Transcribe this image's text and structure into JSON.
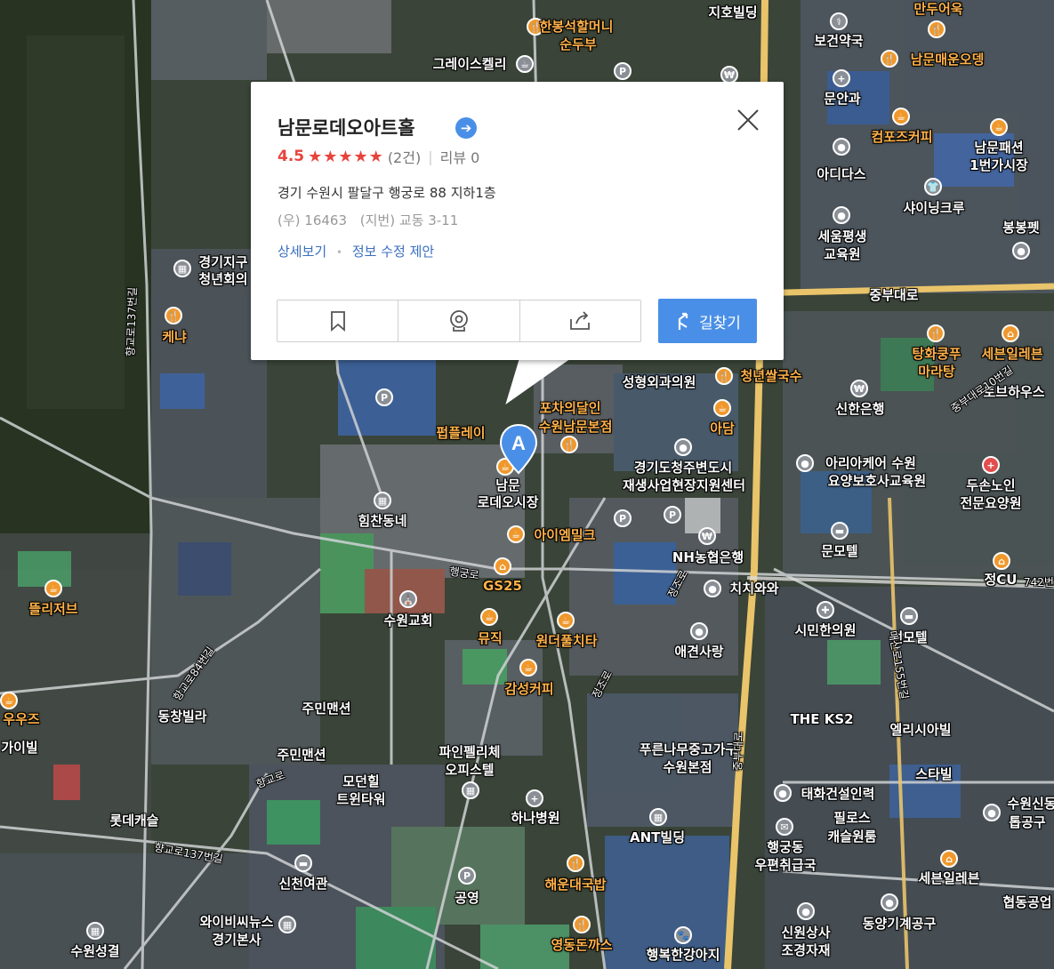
{
  "popup": {
    "title": "남문로데오아트홀",
    "rating_score": "4.5",
    "rating_stars": "★★★★★",
    "rating_count": "(2건)",
    "review_label": "리뷰 0",
    "address": "경기 수원시 팔달구 행궁로 88 지하1층",
    "postal": "(우) 16463",
    "lot_address": "(지번) 교동 3-11",
    "link_detail": "상세보기",
    "link_edit": "정보 수정 제안",
    "route_label": "길찾기"
  },
  "pin_letter": "A",
  "colors": {
    "accent_blue": "#4a8fe7",
    "star_red": "#e7433d",
    "road_yellow": "#e9c46a",
    "label_orange": "#ffb24a"
  },
  "labels": [
    {
      "text": "한봉석할머니",
      "style": "orange"
    },
    {
      "text": "순두부",
      "style": "orange"
    },
    {
      "text": "지호빌딩",
      "style": "white"
    },
    {
      "text": "만두어욱",
      "style": "orange"
    },
    {
      "text": "보건약국",
      "style": "white"
    },
    {
      "text": "그레이스켈리",
      "style": "white"
    },
    {
      "text": "남문매운오뎅",
      "style": "orange"
    },
    {
      "text": "문안과",
      "style": "white"
    },
    {
      "text": "컴포즈커피",
      "style": "orange"
    },
    {
      "text": "남문패션",
      "style": "white"
    },
    {
      "text": "1번가시장",
      "style": "white"
    },
    {
      "text": "아디다스",
      "style": "white"
    },
    {
      "text": "샤이닝크루",
      "style": "white"
    },
    {
      "text": "세움평생",
      "style": "white"
    },
    {
      "text": "교육원",
      "style": "white"
    },
    {
      "text": "봉봉펫",
      "style": "white"
    },
    {
      "text": "경기지구",
      "style": "white"
    },
    {
      "text": "청년회의",
      "style": "white"
    },
    {
      "text": "중부대로",
      "style": "white"
    },
    {
      "text": "케냐",
      "style": "orange"
    },
    {
      "text": "탕화쿵푸",
      "style": "orange"
    },
    {
      "text": "마라탕",
      "style": "orange"
    },
    {
      "text": "세븐일레븐",
      "style": "orange"
    },
    {
      "text": "토브하우스",
      "style": "white"
    },
    {
      "text": "성형외과의원",
      "style": "white"
    },
    {
      "text": "청년쌀국수",
      "style": "orange"
    },
    {
      "text": "신한은행",
      "style": "white"
    },
    {
      "text": "포차의달인",
      "style": "orange"
    },
    {
      "text": "수원남문본점",
      "style": "orange"
    },
    {
      "text": "펍플레이",
      "style": "orange"
    },
    {
      "text": "아담",
      "style": "orange"
    },
    {
      "text": "경기도청주변도시",
      "style": "white"
    },
    {
      "text": "재생사업현장지원센터",
      "style": "white"
    },
    {
      "text": "아리아케어 수원",
      "style": "white"
    },
    {
      "text": "요양보호사교육원",
      "style": "white"
    },
    {
      "text": "두손노인",
      "style": "white"
    },
    {
      "text": "전문요양원",
      "style": "white"
    },
    {
      "text": "남문",
      "style": "white"
    },
    {
      "text": "로데오시장",
      "style": "white"
    },
    {
      "text": "힘찬동네",
      "style": "white"
    },
    {
      "text": "아이엠밀크",
      "style": "orange"
    },
    {
      "text": "NH농협은행",
      "style": "white"
    },
    {
      "text": "문모텔",
      "style": "white"
    },
    {
      "text": "GS25",
      "style": "orange"
    },
    {
      "text": "치치와와",
      "style": "white"
    },
    {
      "text": "정CU",
      "style": "white"
    },
    {
      "text": "뜰리저브",
      "style": "orange"
    },
    {
      "text": "수원교회",
      "style": "white"
    },
    {
      "text": "뮤직",
      "style": "orange"
    },
    {
      "text": "원더풀치타",
      "style": "orange"
    },
    {
      "text": "시민한의원",
      "style": "white"
    },
    {
      "text": "썬모텔",
      "style": "white"
    },
    {
      "text": "애견사랑",
      "style": "white"
    },
    {
      "text": "우우즈",
      "style": "orange"
    },
    {
      "text": "동창빌라",
      "style": "white"
    },
    {
      "text": "감성커피",
      "style": "orange"
    },
    {
      "text": "주민맨션",
      "style": "white"
    },
    {
      "text": "THE KS2",
      "style": "white"
    },
    {
      "text": "엘리시아빌",
      "style": "white"
    },
    {
      "text": "가이빌",
      "style": "white"
    },
    {
      "text": "파인펠리체",
      "style": "white"
    },
    {
      "text": "오피스텔",
      "style": "white"
    },
    {
      "text": "푸른나무중고가구",
      "style": "white"
    },
    {
      "text": "수원본점",
      "style": "white"
    },
    {
      "text": "주민맨션",
      "style": "white"
    },
    {
      "text": "스타빌",
      "style": "white"
    },
    {
      "text": "모던힐",
      "style": "white"
    },
    {
      "text": "트윈타워",
      "style": "white"
    },
    {
      "text": "태화건설인력",
      "style": "white"
    },
    {
      "text": "수원신동",
      "style": "white"
    },
    {
      "text": "롯데캐슬",
      "style": "white"
    },
    {
      "text": "하나병원",
      "style": "white"
    },
    {
      "text": "필로스",
      "style": "white"
    },
    {
      "text": "캐슬원룸",
      "style": "white"
    },
    {
      "text": "톱공구",
      "style": "white"
    },
    {
      "text": "ANT빌딩",
      "style": "white"
    },
    {
      "text": "행궁동",
      "style": "white"
    },
    {
      "text": "우편취급국",
      "style": "white"
    },
    {
      "text": "해운대국밥",
      "style": "orange"
    },
    {
      "text": "세븐일레븐",
      "style": "white"
    },
    {
      "text": "신천여관",
      "style": "white"
    },
    {
      "text": "공영",
      "style": "white"
    },
    {
      "text": "협동공업",
      "style": "white"
    },
    {
      "text": "와이비씨뉴스",
      "style": "white"
    },
    {
      "text": "경기본사",
      "style": "white"
    },
    {
      "text": "동양기계공구",
      "style": "white"
    },
    {
      "text": "신원상사",
      "style": "white"
    },
    {
      "text": "조경자재",
      "style": "white"
    },
    {
      "text": "수원성결",
      "style": "white"
    },
    {
      "text": "영동돈까스",
      "style": "orange"
    },
    {
      "text": "행복한강아지",
      "style": "white"
    }
  ],
  "road_labels": [
    "향교로137번길",
    "항교로84번길",
    "향교로",
    "향교로137번길",
    "행궁로",
    "정조로",
    "정조로",
    "중부대로",
    "매산로155번길",
    "중부대로10번길",
    "742번"
  ]
}
